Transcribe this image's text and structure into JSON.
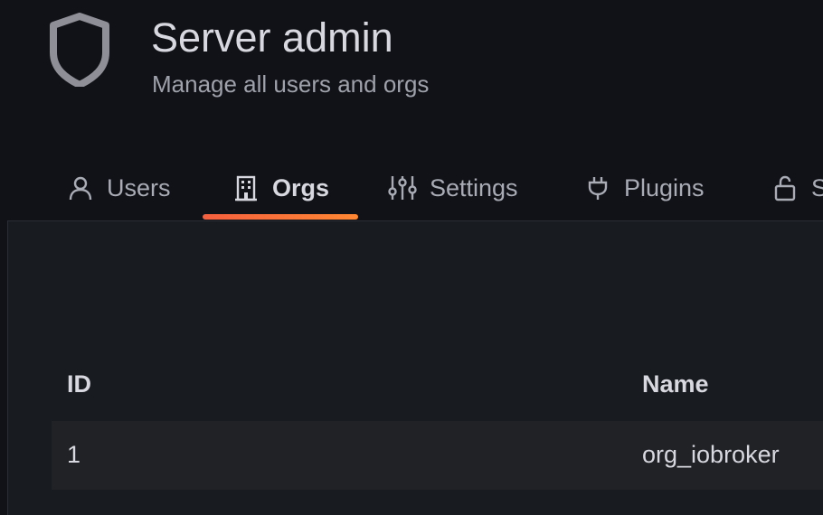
{
  "header": {
    "title": "Server admin",
    "subtitle": "Manage all users and orgs",
    "icon": "shield-icon"
  },
  "tabs": [
    {
      "label": "Users",
      "icon": "user-icon",
      "active": false
    },
    {
      "label": "Orgs",
      "icon": "building-icon",
      "active": true
    },
    {
      "label": "Settings",
      "icon": "sliders-icon",
      "active": false
    },
    {
      "label": "Plugins",
      "icon": "plug-icon",
      "active": false
    },
    {
      "label": "S",
      "icon": "lock-icon",
      "active": false
    }
  ],
  "table": {
    "columns": [
      "ID",
      "Name"
    ],
    "rows": [
      {
        "id": "1",
        "name": "org_iobroker"
      }
    ]
  },
  "colors": {
    "background": "#111217",
    "panel": "#181b1f",
    "accent_start": "#f55f3e",
    "accent_end": "#ff8833"
  }
}
